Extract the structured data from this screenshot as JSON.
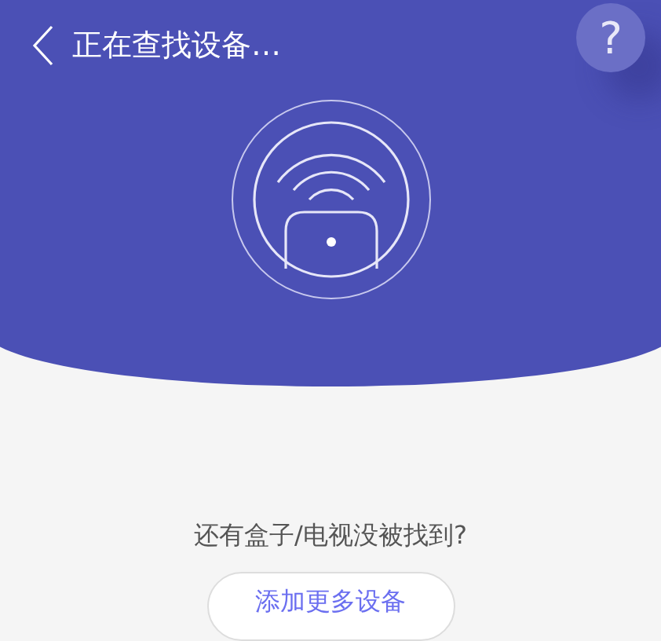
{
  "header": {
    "title": "正在查找设备…",
    "help": "?"
  },
  "prompt": "还有盒子/电视没被找到?",
  "add_button": "添加更多设备"
}
